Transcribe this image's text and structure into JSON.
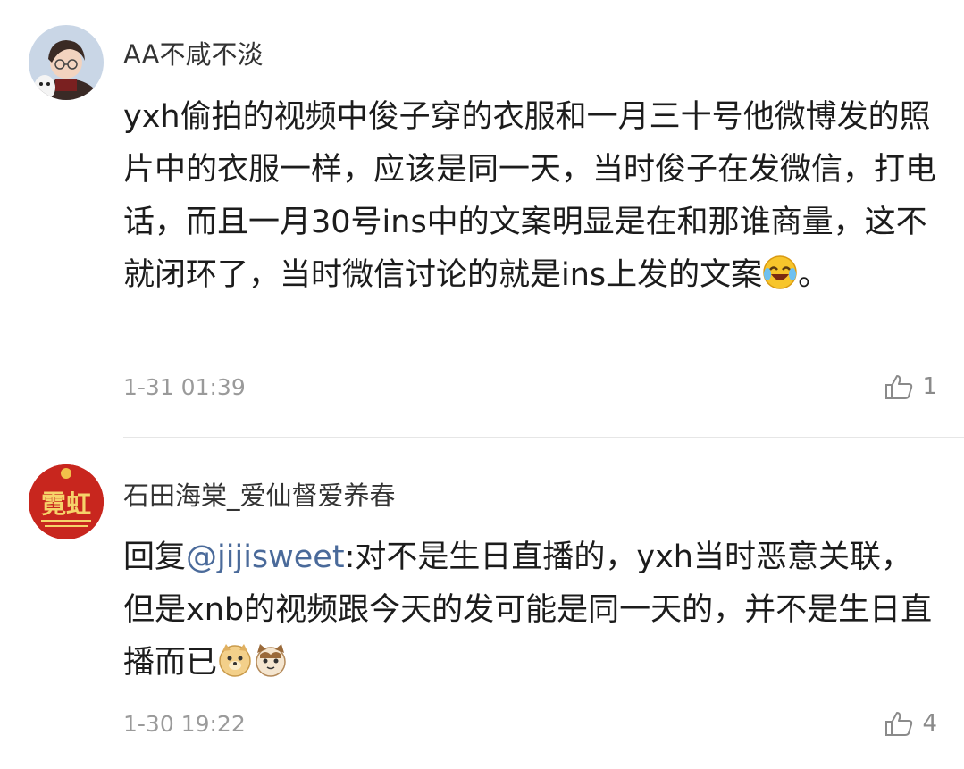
{
  "comments": [
    {
      "username": "AA不咸不淡",
      "text_before": "yxh偷拍的视频中俊子穿的衣服和一月三十号他微博发的照片中的衣服一样，应该是同一天，当时俊子在发微信，打电话，而且一月30号ins中的文案明显是在和那谁商量，这不就闭环了，当时微信讨论的就是ins上发的文案",
      "text_after": "。",
      "emoji": [
        "laugh-cry-emoji"
      ],
      "timestamp": "1-31 01:39",
      "likes": "1"
    },
    {
      "username": "石田海棠_爱仙督爱养春",
      "avatar_text": "霓虹",
      "reply_prefix": "回复",
      "mention": "@jijisweet",
      "text_before": ":对不是生日直播的，yxh当时恶意关联，但是xnb的视频跟今天的发可能是同一天的，并不是生日直播而已",
      "emoji": [
        "doge-emoji",
        "cat-emoji"
      ],
      "timestamp": "1-30 19:22",
      "likes": "4"
    }
  ],
  "colors": {
    "mention": "#4a6a9a",
    "timestamp": "#9a9a9a",
    "avatar2_bg": "#c8261e"
  },
  "icons": [
    "thumbs-up-icon"
  ]
}
